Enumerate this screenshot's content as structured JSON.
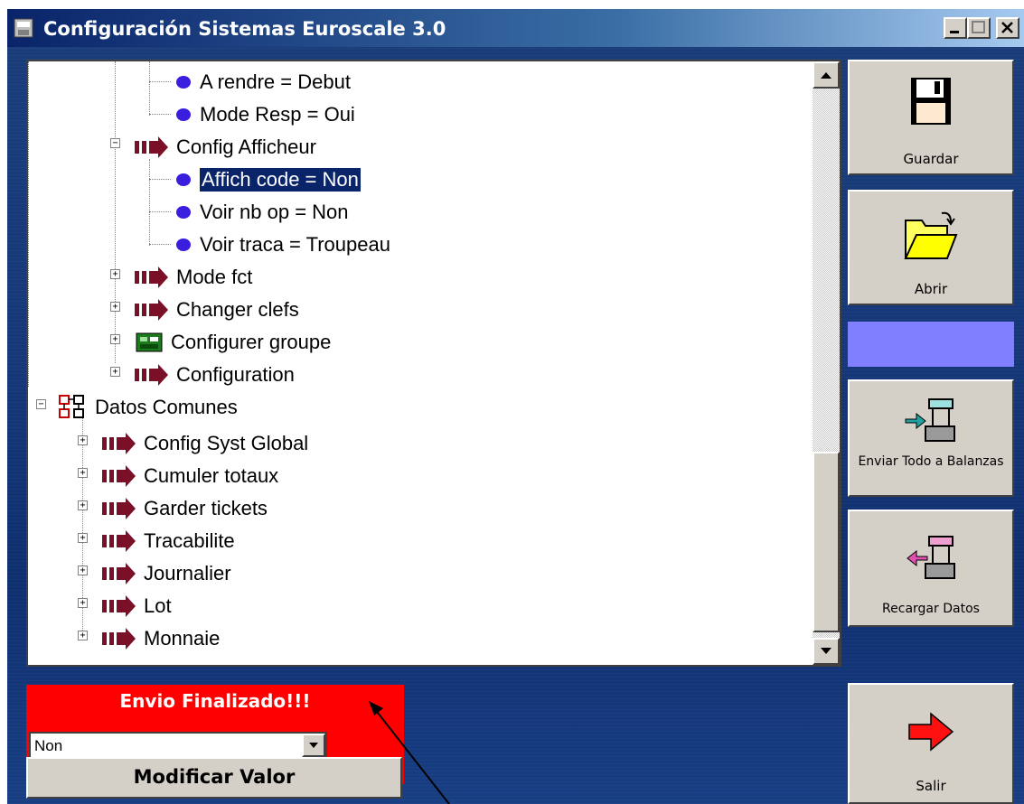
{
  "window": {
    "title": "Configuración Sistemas Euroscale 3.0",
    "controls": [
      "minimize",
      "maximize",
      "close"
    ]
  },
  "tree": {
    "items": [
      {
        "label": "A rendre = Debut",
        "icon": "bullet-icon",
        "level": 3
      },
      {
        "label": "Mode Resp  = Oui",
        "icon": "bullet-icon",
        "level": 3
      },
      {
        "label": "Config  Afficheur",
        "icon": "arrow-right-icon",
        "level": 2,
        "expanded": true
      },
      {
        "label": "Affich  code = Non",
        "icon": "bullet-icon",
        "level": 3,
        "selected": true
      },
      {
        "label": "Voir nb op  = Non",
        "icon": "bullet-icon",
        "level": 3
      },
      {
        "label": "Voir traca = Troupeau",
        "icon": "bullet-icon",
        "level": 3
      },
      {
        "label": "Mode fct",
        "icon": "arrow-right-icon",
        "level": 2,
        "expanded": false
      },
      {
        "label": "Changer clefs",
        "icon": "arrow-right-icon",
        "level": 2,
        "expanded": false
      },
      {
        "label": "Configurer groupe",
        "icon": "group-icon",
        "level": 2,
        "expanded": false
      },
      {
        "label": "Configuration",
        "icon": "arrow-right-icon",
        "level": 2,
        "expanded": false
      },
      {
        "label": "Datos Comunes",
        "icon": "network-icon",
        "level": 0,
        "expanded": true
      },
      {
        "label": "Config  Syst  Global",
        "icon": "arrow-right-icon",
        "level": 1,
        "expanded": false
      },
      {
        "label": "Cumuler totaux",
        "icon": "arrow-right-icon",
        "level": 1,
        "expanded": false
      },
      {
        "label": "Garder tickets",
        "icon": "arrow-right-icon",
        "level": 1,
        "expanded": false
      },
      {
        "label": "Tracabilite",
        "icon": "arrow-right-icon",
        "level": 1,
        "expanded": false
      },
      {
        "label": "Journalier",
        "icon": "arrow-right-icon",
        "level": 1,
        "expanded": false
      },
      {
        "label": "Lot",
        "icon": "arrow-right-icon",
        "level": 1,
        "expanded": false
      },
      {
        "label": "Monnaie",
        "icon": "arrow-right-icon",
        "level": 1,
        "expanded": false
      }
    ]
  },
  "side_buttons": {
    "save": "Guardar",
    "open": "Abrir",
    "send_all": "Enviar Todo a Balanzas",
    "reload": "Recargar Datos",
    "exit": "Salir"
  },
  "status": {
    "message": "Envio Finalizado!!!",
    "color": "#ff0000"
  },
  "value_select": {
    "selected": "Non"
  },
  "modify_button": "Modificar Valor",
  "colors": {
    "title_bar": "#0a246a",
    "accent_bar": "#7f7fff",
    "background": "#163879",
    "arrow_icon": "#7a1028",
    "bullet": "#3a1ee0"
  }
}
